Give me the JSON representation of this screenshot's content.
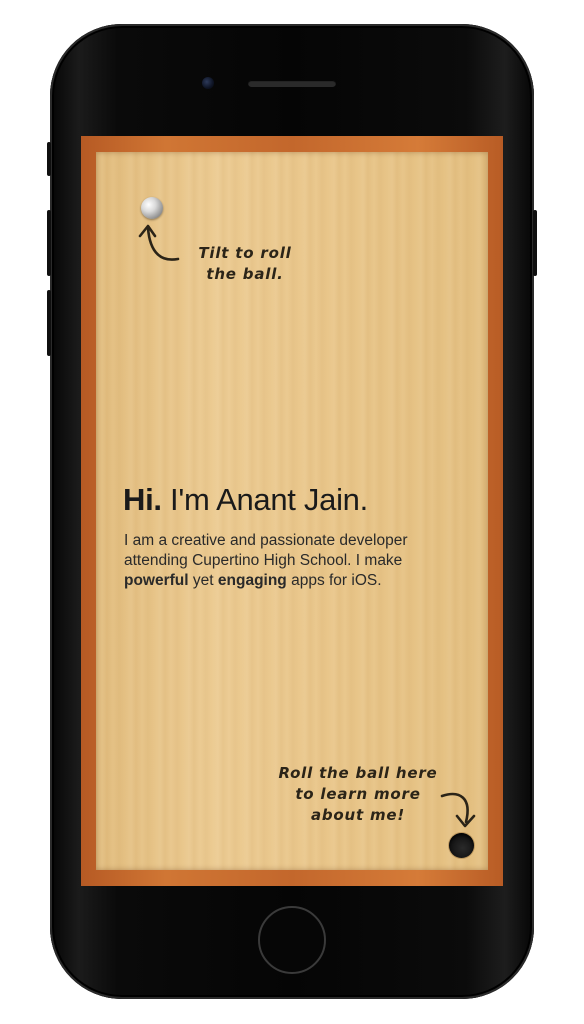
{
  "device": {
    "model": "iphone-mockup",
    "frame_color": "#0a0a0a"
  },
  "board": {
    "wood_color": "#e8c588",
    "border_color": "#c4682c",
    "ball": {
      "icon": "silver-ball-icon"
    },
    "hole": {
      "icon": "goal-hole-icon"
    }
  },
  "hints": {
    "top_line1": "Tilt to roll",
    "top_line2": "the ball.",
    "bottom_line1": "Roll the ball here",
    "bottom_line2": "to learn more",
    "bottom_line3": "about me!"
  },
  "hero": {
    "greeting": "Hi.",
    "name": "I'm Anant Jain.",
    "intro_part1": "I am a creative and passionate developer attending Cupertino High School. I make ",
    "word_powerful": "powerful",
    "word_yet": " yet ",
    "word_engaging": "engaging",
    "intro_part2": " apps for iOS."
  }
}
